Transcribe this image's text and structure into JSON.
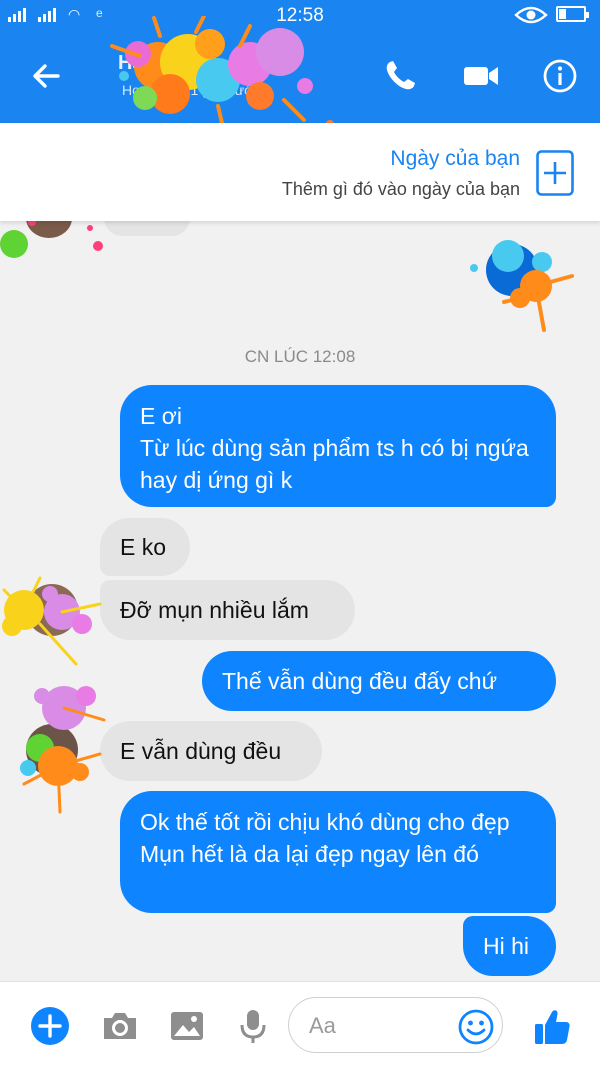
{
  "status_bar": {
    "time": "12:58",
    "carrier_text": "e"
  },
  "header": {
    "contact_name": "Hà Linh",
    "contact_status": "Hoạt động 1 giờ trước"
  },
  "day_banner": {
    "title": "Ngày của bạn",
    "subtitle": "Thêm gì đó vào ngày của bạn"
  },
  "conversation": {
    "timestamp": "CN LÚC 12:08",
    "messages": [
      {
        "side": "out",
        "text": "E ơi\nTừ lúc dùng sản phẩm ts h có bị ngứa hay dị ứng gì k"
      },
      {
        "side": "in",
        "text": "E ko"
      },
      {
        "side": "in",
        "text": "Đỡ mụn nhiều lắm"
      },
      {
        "side": "out",
        "text": "Thế vẫn dùng đều đấy chứ"
      },
      {
        "side": "in",
        "text": "E vẫn dùng đều"
      },
      {
        "side": "out",
        "text": "Ok thế tốt rồi chịu khó dùng cho đẹp\nMụn hết là da lại đẹp ngay lên đó"
      },
      {
        "side": "out",
        "text": "Hi hi"
      }
    ]
  },
  "composer": {
    "placeholder": "Aa"
  },
  "icons": {
    "back": "arrow-left-icon",
    "call": "phone-icon",
    "video": "video-camera-icon",
    "info": "info-icon",
    "add": "plus-circle-icon",
    "camera": "camera-icon",
    "gallery": "image-icon",
    "mic": "microphone-icon",
    "emoji": "smiley-icon",
    "like": "thumbs-up-icon",
    "new_day": "plus-square-icon"
  },
  "colors": {
    "brand": "#1a84f0",
    "bubble_out": "#0e84ff",
    "bubble_in": "#e4e4e4",
    "background": "#f1f1f1"
  }
}
